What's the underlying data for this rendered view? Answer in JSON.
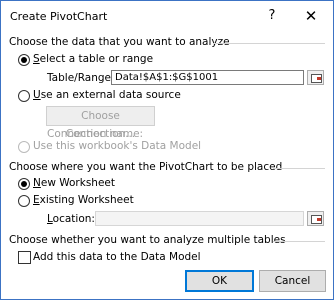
{
  "window": {
    "title": "Create PivotChart",
    "help_glyph": "?",
    "close_glyph": "✕"
  },
  "data_section": {
    "heading": "Choose the data that you want to analyze",
    "select_range_label": "Select a table or range",
    "table_range_label": "Table/Range:",
    "table_range_value": "Data!$A$1:$G$1001",
    "external_source_label": "Use an external data source",
    "choose_connection_label": "Choose Connection...",
    "connection_name_label": "Connection name:",
    "data_model_label": "Use this workbook's Data Model"
  },
  "placement_section": {
    "heading": "Choose where you want the PivotChart to be placed",
    "new_worksheet_label": "New Worksheet",
    "existing_worksheet_label": "Existing Worksheet",
    "location_label": "Location:",
    "location_value": ""
  },
  "multiple_tables_section": {
    "heading": "Choose whether you want to analyze multiple tables",
    "add_to_model_label": "Add this data to the Data Model"
  },
  "buttons": {
    "ok_label": "OK",
    "cancel_label": "Cancel"
  },
  "state": {
    "data_source": "Select a table or range",
    "placement": "New Worksheet",
    "add_to_data_model": false
  }
}
